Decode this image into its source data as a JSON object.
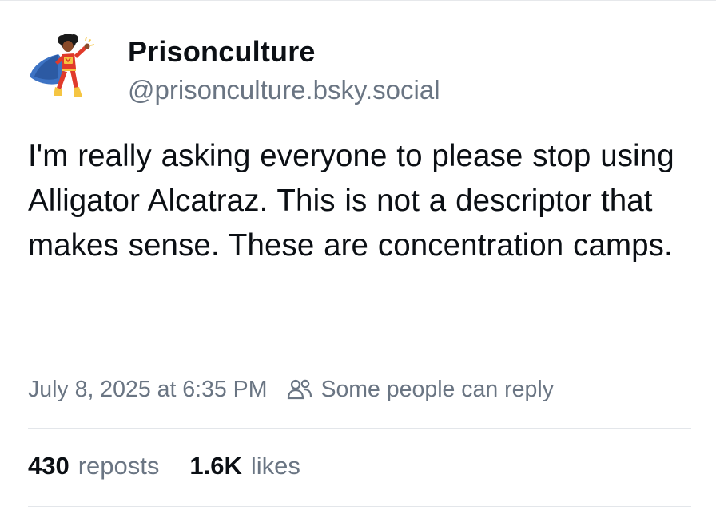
{
  "post": {
    "author": {
      "display_name": "Prisonculture",
      "handle": "@prisonculture.bsky.social",
      "avatar_icon": "superhero-avatar-icon"
    },
    "text": "I'm really asking everyone to please stop using Alligator Alcatraz. This is not a descriptor that makes sense. These are concentration camps.",
    "timestamp": "July 8, 2025 at 6:35 PM",
    "reply_scope": {
      "icon": "people-icon",
      "label": "Some people can reply"
    },
    "stats": {
      "reposts_count": "430",
      "reposts_label": "reposts",
      "likes_count": "1.6K",
      "likes_label": "likes"
    }
  },
  "colors": {
    "text_primary": "#0b0f14",
    "text_secondary": "#6a7583",
    "divider": "#e3e6ea",
    "background": "#ffffff"
  }
}
